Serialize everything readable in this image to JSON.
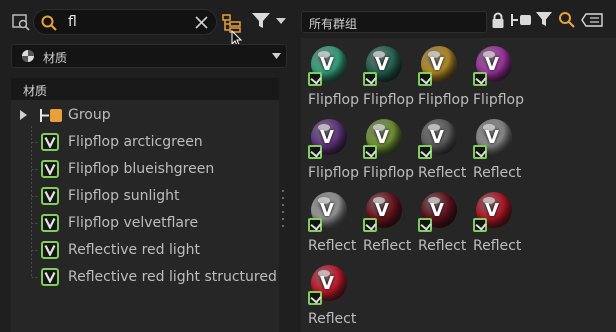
{
  "search": {
    "value": "fl"
  },
  "category_dropdown": {
    "selected": "材质"
  },
  "tree": {
    "header": "材质",
    "group_label": "Group",
    "items": [
      "Flipflop arcticgreen",
      "Flipflop blueishgreen",
      "Flipflop sunlight",
      "Flipflop velvetflare",
      "Reflective red light",
      "Reflective red light structured"
    ]
  },
  "scope": {
    "label": "所有群组"
  },
  "materials": [
    {
      "name": "Flipflop",
      "color": "#3bb58e"
    },
    {
      "name": "Flipflop",
      "color": "#2c6e5e"
    },
    {
      "name": "Flipflop",
      "color": "#c99a2a"
    },
    {
      "name": "Flipflop",
      "color": "#b23ab6"
    },
    {
      "name": "Flipflop",
      "color": "#6e3c90"
    },
    {
      "name": "Flipflop",
      "color": "#7fa33a"
    },
    {
      "name": "Reflect",
      "color": "#6a6a6a"
    },
    {
      "name": "Reflect",
      "color": "#9a9a9a"
    },
    {
      "name": "Reflect",
      "color": "#a8a8a8"
    },
    {
      "name": "Reflect",
      "color": "#7a1520"
    },
    {
      "name": "Reflect",
      "color": "#6e1420"
    },
    {
      "name": "Reflect",
      "color": "#c41a2a"
    },
    {
      "name": "Reflect",
      "color": "#d81c30"
    }
  ],
  "colors": {
    "accent_orange": "#e8a13a",
    "material_badge_green": "#7fcf5a"
  }
}
